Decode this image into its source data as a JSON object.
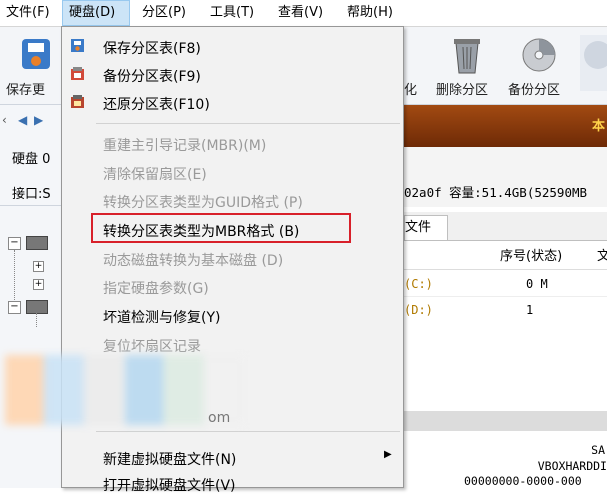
{
  "menubar": {
    "items": [
      {
        "label": "文件(F)"
      },
      {
        "label": "硬盘(D)"
      },
      {
        "label": "分区(P)"
      },
      {
        "label": "工具(T)"
      },
      {
        "label": "查看(V)"
      },
      {
        "label": "帮助(H)"
      }
    ]
  },
  "toolbar": {
    "save_label": "保存更",
    "partial_label": "化",
    "delete_partition_label": "删除分区",
    "backup_partition_label": "备份分区"
  },
  "left_panel": {
    "disk_label": "硬盘 0",
    "interface_label": "接口:S"
  },
  "banner": {
    "text": "本"
  },
  "disk_info": {
    "text": "02a0f  容量:51.4GB(52590MB"
  },
  "tabs": {
    "files_label": "文件"
  },
  "table": {
    "headers": [
      "序号(状态)",
      "文"
    ],
    "rows": [
      {
        "name": "(C:)",
        "index": "0 M"
      },
      {
        "name": "(D:)",
        "index": "1"
      }
    ]
  },
  "bottom_panel": {
    "line1": "SA",
    "line2": "VBOXHARDDI",
    "line3": "00000000-0000-000"
  },
  "dropdown": {
    "items": [
      {
        "label": "保存分区表(F8)",
        "enabled": true
      },
      {
        "label": "备份分区表(F9)",
        "enabled": true
      },
      {
        "label": "还原分区表(F10)",
        "enabled": true
      },
      {
        "label": "重建主引导记录(MBR)(M)",
        "enabled": false
      },
      {
        "label": "清除保留扇区(E)",
        "enabled": false
      },
      {
        "label": "转换分区表类型为GUID格式 (P)",
        "enabled": false
      },
      {
        "label": "转换分区表类型为MBR格式 (B)",
        "enabled": true
      },
      {
        "label": "动态磁盘转换为基本磁盘 (D)",
        "enabled": false
      },
      {
        "label": "指定硬盘参数(G)",
        "enabled": false
      },
      {
        "label": "坏道检测与修复(Y)",
        "enabled": true
      },
      {
        "label": "复位坏扇区记录",
        "enabled": false
      },
      {
        "label": "新建虚拟硬盘文件(N)",
        "enabled": true
      },
      {
        "label": "打开虚拟硬盘文件(V)",
        "enabled": true
      }
    ],
    "highlight_color": "#d8202a"
  },
  "watermark": {
    "text": "om"
  },
  "colors": {
    "menu_active": "#cce4f7",
    "banner": "#8a3a0a",
    "banner_text": "#ffd24a"
  }
}
